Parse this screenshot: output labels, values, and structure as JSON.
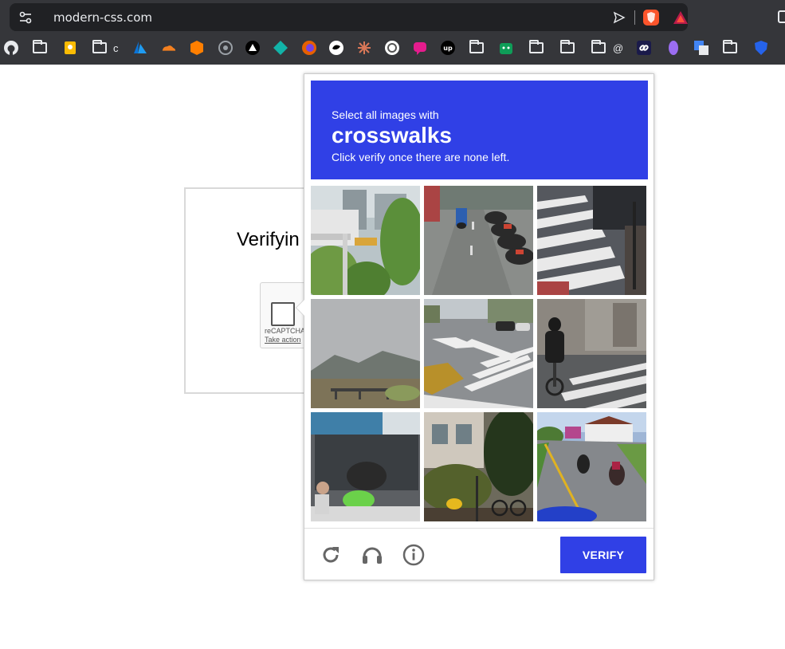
{
  "browser": {
    "url": "modern-css.com",
    "bookmark_labels": {
      "folder_c": "c",
      "folder_at": "@"
    }
  },
  "page": {
    "title": "Verifyin",
    "recaptcha_brand": "reCAPTCHA",
    "recaptcha_action": "Take action"
  },
  "challenge": {
    "instruction": "Select all images with",
    "target": "crosswalks",
    "note": "Click verify once there are none left.",
    "verify_label": "VERIFY",
    "accent": "#3040e6",
    "tiles": [
      "Building behind trees",
      "Parked motorcycles on street",
      "Crosswalk stripes",
      "Bridge and mountains",
      "Intersection crosswalk",
      "Cyclist on crosswalk",
      "Market stall",
      "Bicycle by building",
      "Motorcyclists on road"
    ]
  }
}
